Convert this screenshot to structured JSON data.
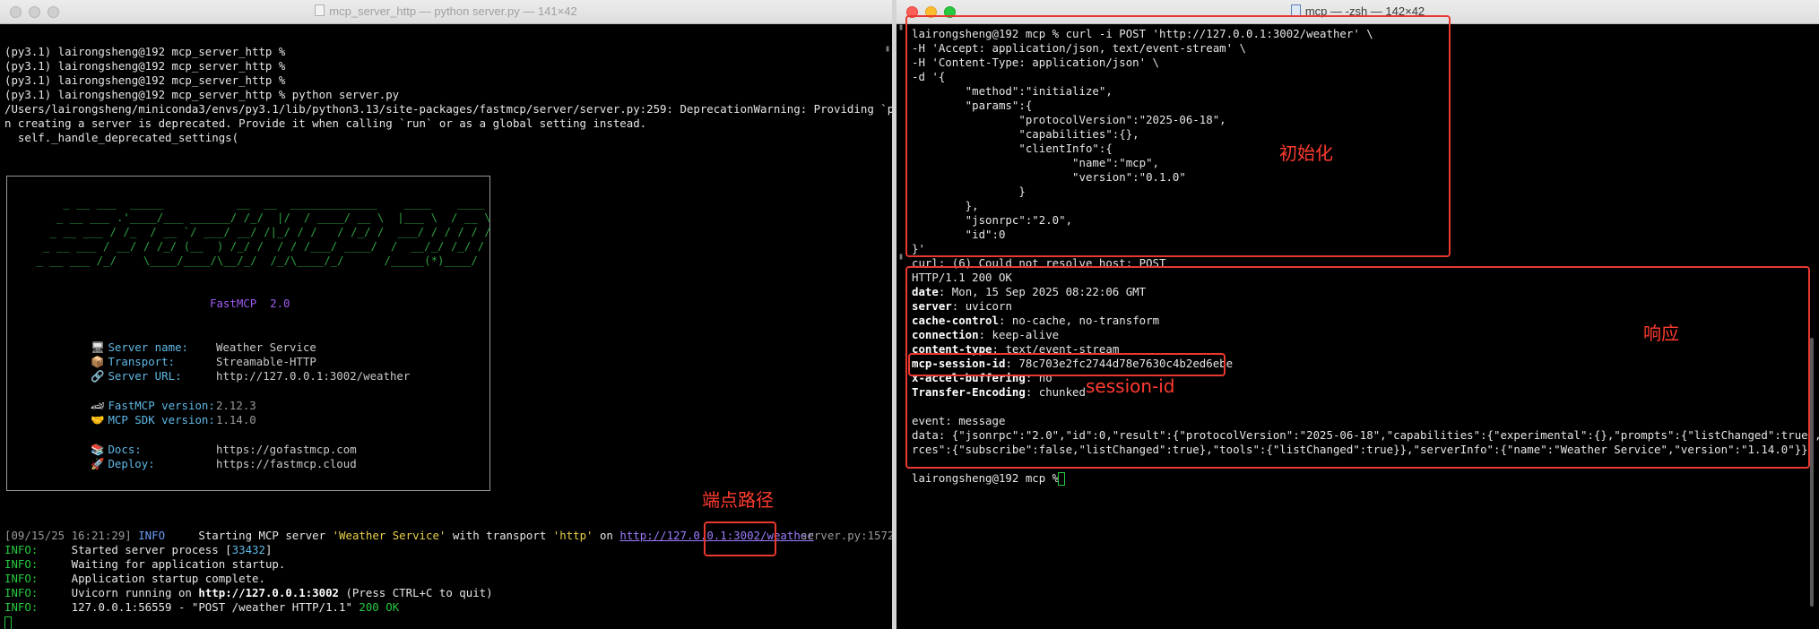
{
  "left_window": {
    "title": "mcp_server_http — python server.py — 141×42",
    "lines_top": [
      "(py3.1) lairongsheng@192 mcp_server_http %",
      "(py3.1) lairongsheng@192 mcp_server_http %",
      "(py3.1) lairongsheng@192 mcp_server_http %",
      "(py3.1) lairongsheng@192 mcp_server_http % python server.py",
      "/Users/lairongsheng/miniconda3/envs/py3.1/lib/python3.13/site-packages/fastmcp/server/server.py:259: DeprecationWarning: Providing `port` whe",
      "n creating a server is deprecated. Provide it when calling `run` or as a global setting instead.",
      "  self._handle_deprecated_settings("
    ],
    "banner": {
      "logo_lines": [
        "     _ __ ___  _____           __  __  _____________    ____    ____ ",
        "    _ __ ___ .'____/___ ______/ /_/  |/  / ____/ __ \\  |___ \\  / __ \\",
        "   _ __ ___ / /_  / __ `/ ___/ __/ /|_/ / /   / /_/ /  ___/ / / / / /",
        "  _ __ ___ / __/ / /_/ (__  ) /_/ /  / / /___/ ____/  /  __/_/ /_/ / ",
        " _ __ ___ /_/    \\____/____/\\__/_/  /_/\\____/_/      /_____(*)____/  "
      ],
      "product": "FastMCP  2.0",
      "info": [
        {
          "icon": "monitor-icon",
          "glyph": "🖥",
          "label": "Server name:",
          "value": "Weather Service"
        },
        {
          "icon": "package-icon",
          "glyph": "📦",
          "label": "Transport:",
          "value": "Streamable-HTTP"
        },
        {
          "icon": "link-icon",
          "glyph": "🔗",
          "label": "Server URL:",
          "value": "http://127.0.0.1:3002/weather"
        },
        {
          "icon": "race-car-icon",
          "glyph": "🏎",
          "label": "FastMCP version:",
          "value": "2.12.3"
        },
        {
          "icon": "handshake-icon",
          "glyph": "🤝",
          "label": "MCP SDK version:",
          "value": "1.14.0"
        },
        {
          "icon": "books-icon",
          "glyph": "📚",
          "label": "Docs:",
          "value": "https://gofastmcp.com"
        },
        {
          "icon": "rocket-icon",
          "glyph": "🚀",
          "label": "Deploy:",
          "value": "https://fastmcp.cloud"
        }
      ]
    },
    "log": {
      "ts": "[09/15/25 16:21:29]",
      "level": "INFO",
      "msg_start": "     Starting MCP server ",
      "msg_name": "'Weather Service'",
      "msg_mid": " with transport ",
      "msg_transport": "'http'",
      "msg_on": " on ",
      "url": "http://127.0.0.1:3002/weather",
      "src": "server.py:1572"
    },
    "info_lines": [
      {
        "level": "INFO:",
        "msg": "     Started server process [",
        "pid": "33432",
        "tail": "]"
      },
      {
        "level": "INFO:",
        "msg": "     Waiting for application startup."
      },
      {
        "level": "INFO:",
        "msg": "     Application startup complete."
      },
      {
        "level": "INFO:",
        "msg": "     Uvicorn running on ",
        "bold": "http://127.0.0.1:3002",
        "tail": " (Press CTRL+C to quit)"
      },
      {
        "level": "INFO:",
        "msg": "     127.0.0.1:56559 - \"POST /weather HTTP/1.1\" ",
        "status": "200 OK"
      }
    ],
    "annotation": "端点路径"
  },
  "right_window": {
    "title": "mcp — -zsh — 142×42",
    "request_lines": [
      "lairongsheng@192 mcp % curl -i POST 'http://127.0.0.1:3002/weather' \\",
      "-H 'Accept: application/json, text/event-stream' \\",
      "-H 'Content-Type: application/json' \\",
      "-d '{",
      "        \"method\":\"initialize\",",
      "        \"params\":{",
      "                \"protocolVersion\":\"2025-06-18\",",
      "                \"capabilities\":{},",
      "                \"clientInfo\":{",
      "                        \"name\":\"mcp\",",
      "                        \"version\":\"0.1.0\"",
      "                }",
      "        },",
      "        \"jsonrpc\":\"2.0\",",
      "        \"id\":0",
      "}'"
    ],
    "curl_error": "curl: (6) Could not resolve host: POST",
    "status_line": "HTTP/1.1 200 OK",
    "headers": [
      {
        "k": "date",
        "v": " Mon, 15 Sep 2025 08:22:06 GMT"
      },
      {
        "k": "server",
        "v": " uvicorn"
      },
      {
        "k": "cache-control",
        "v": " no-cache, no-transform"
      },
      {
        "k": "connection",
        "v": " keep-alive"
      },
      {
        "k": "content-type",
        "v": " text/event-stream"
      },
      {
        "k": "mcp-session-id",
        "v": " 78c703e2fc2744d78e7630c4b2ed6ebe"
      },
      {
        "k": "x-accel-buffering",
        "v": " no"
      },
      {
        "k": "Transfer-Encoding",
        "v": " chunked"
      }
    ],
    "event_line": "event: message",
    "data_line1": "data: {\"jsonrpc\":\"2.0\",\"id\":0,\"result\":{\"protocolVersion\":\"2025-06-18\",\"capabilities\":{\"experimental\":{},\"prompts\":{\"listChanged\":true},\"resou",
    "data_line2": "rces\":{\"subscribe\":false,\"listChanged\":true},\"tools\":{\"listChanged\":true}},\"serverInfo\":{\"name\":\"Weather Service\",\"version\":\"1.14.0\"}}}",
    "prompt": "lairongsheng@192 mcp % ",
    "annotations": {
      "init": "初始化",
      "response": "响应",
      "session": "session-id"
    }
  }
}
